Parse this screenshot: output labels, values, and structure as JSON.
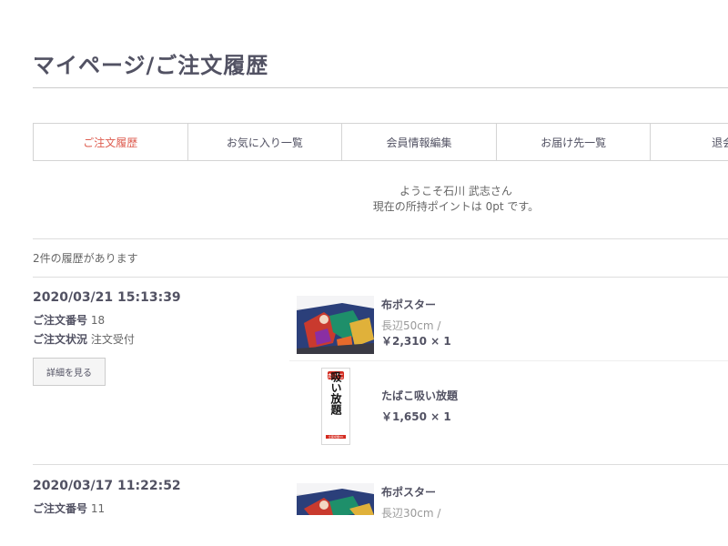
{
  "page": {
    "title": "マイページ/ご注文履歴"
  },
  "nav": {
    "items": [
      {
        "label": "ご注文履歴"
      },
      {
        "label": "お気に入り一覧"
      },
      {
        "label": "会員情報編集"
      },
      {
        "label": "お届け先一覧"
      },
      {
        "label": "退会手"
      }
    ]
  },
  "welcome": {
    "line1": "ようこそ石川 武志さん",
    "line2": "現在の所持ポイントは 0pt です。"
  },
  "history": {
    "count_text": "2件の履歴があります",
    "orders": [
      {
        "date": "2020/03/21 15:13:39",
        "number_label": "ご注文番号",
        "number": "18",
        "status_label": "ご注文状況",
        "status": "注文受付",
        "detail_label": "詳細を見る",
        "items": [
          {
            "name": "布ポスター",
            "size": "長辺50cm /",
            "price": "￥2,310 × 1"
          },
          {
            "name": "たばこ吸い放題",
            "price": "￥1,650 × 1"
          }
        ]
      },
      {
        "date": "2020/03/17 11:22:52",
        "number_label": "ご注文番号",
        "number": "11",
        "items": [
          {
            "name": "布ポスター",
            "size": "長辺30cm /"
          }
        ]
      }
    ]
  },
  "thumbs": {
    "poster_text_top": "たばこ",
    "poster_text_main": "吸い放題",
    "poster_text_sub": "全面喫煙OK"
  },
  "colors": {
    "active_nav": "#de5d50",
    "text": "#525263",
    "poster_red": "#d42a1f"
  }
}
